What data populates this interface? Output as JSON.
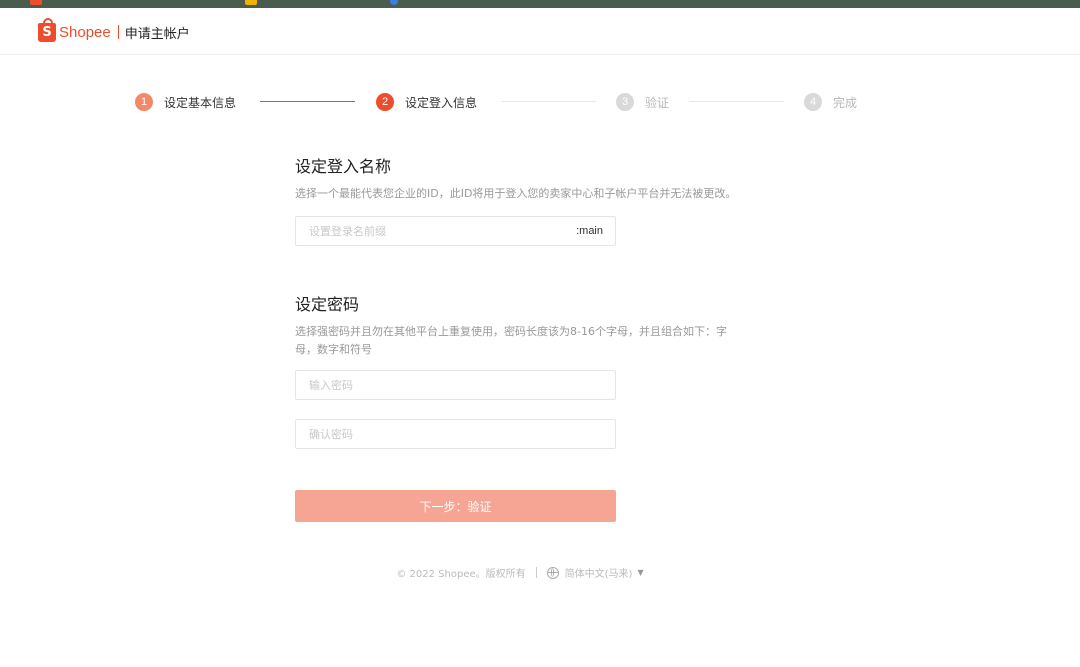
{
  "header": {
    "brand": "Shopee",
    "brand_mark": "S",
    "subtitle": "申请主帐户"
  },
  "steps": [
    {
      "number": "1",
      "label": "设定基本信息",
      "state": "done"
    },
    {
      "number": "2",
      "label": "设定登入信息",
      "state": "active"
    },
    {
      "number": "3",
      "label": "验证",
      "state": "todo"
    },
    {
      "number": "4",
      "label": "完成",
      "state": "todo"
    }
  ],
  "login_section": {
    "title": "设定登入名称",
    "description": "选择一个最能代表您企业的ID，此ID将用于登入您的卖家中心和子帐户平台并无法被更改。",
    "input_placeholder": "设置登录名前缀",
    "input_value": "",
    "suffix": ":main"
  },
  "password_section": {
    "title": "设定密码",
    "description": "选择强密码并且勿在其他平台上重复使用，密码长度该为8-16个字母，并且组合如下：字母，数字和符号",
    "password_placeholder": "输入密码",
    "confirm_placeholder": "确认密码"
  },
  "next_button": "下一步：验证",
  "footer": {
    "copyright": "© 2022 Shopee。版权所有",
    "language": "简体中文(马来)",
    "globe_icon": "globe-icon",
    "caret_icon": "caret-down-icon"
  },
  "colors": {
    "brand": "#ee4d2d",
    "step_done": "#f48967",
    "button_disabled": "#f6a595"
  }
}
